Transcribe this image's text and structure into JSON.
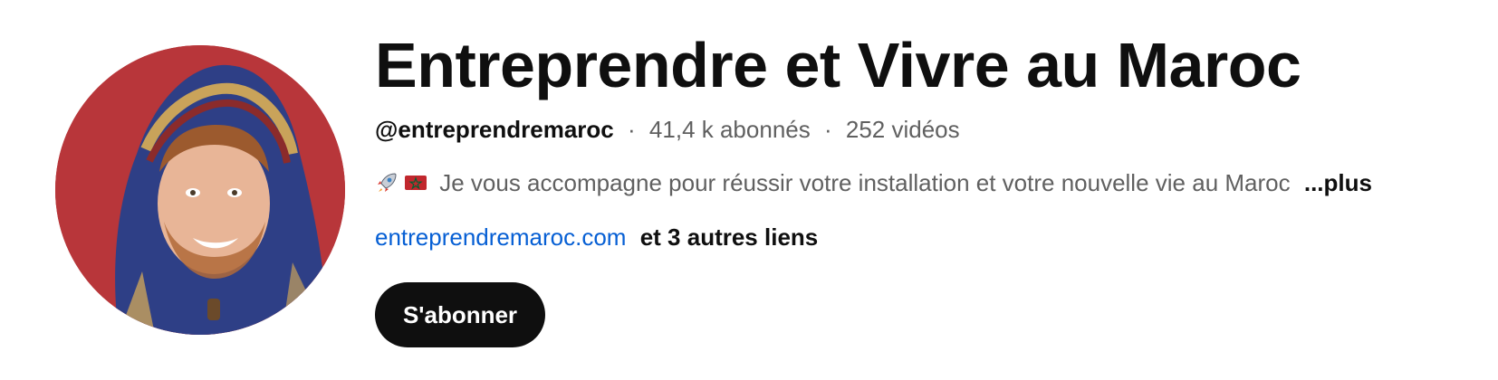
{
  "channel": {
    "title": "Entreprendre et Vivre au Maroc",
    "handle": "@entreprendremaroc",
    "separator": "·",
    "subscribers": "41,4 k abonnés",
    "videos": "252 vidéos",
    "description": "Je vous accompagne pour réussir votre installation et votre nouvelle vie au Maroc",
    "description_icons": [
      "rocket-emoji",
      "morocco-flag-emoji"
    ],
    "more_label": "...plus",
    "link_text": "entreprendremaroc.com",
    "other_links": "et 3 autres liens",
    "subscribe_label": "S'abonner"
  },
  "colors": {
    "avatar_background": "#b8363a",
    "link": "#065fd4",
    "subscribe_button": "#0f0f0f",
    "secondary_text": "#606060"
  }
}
